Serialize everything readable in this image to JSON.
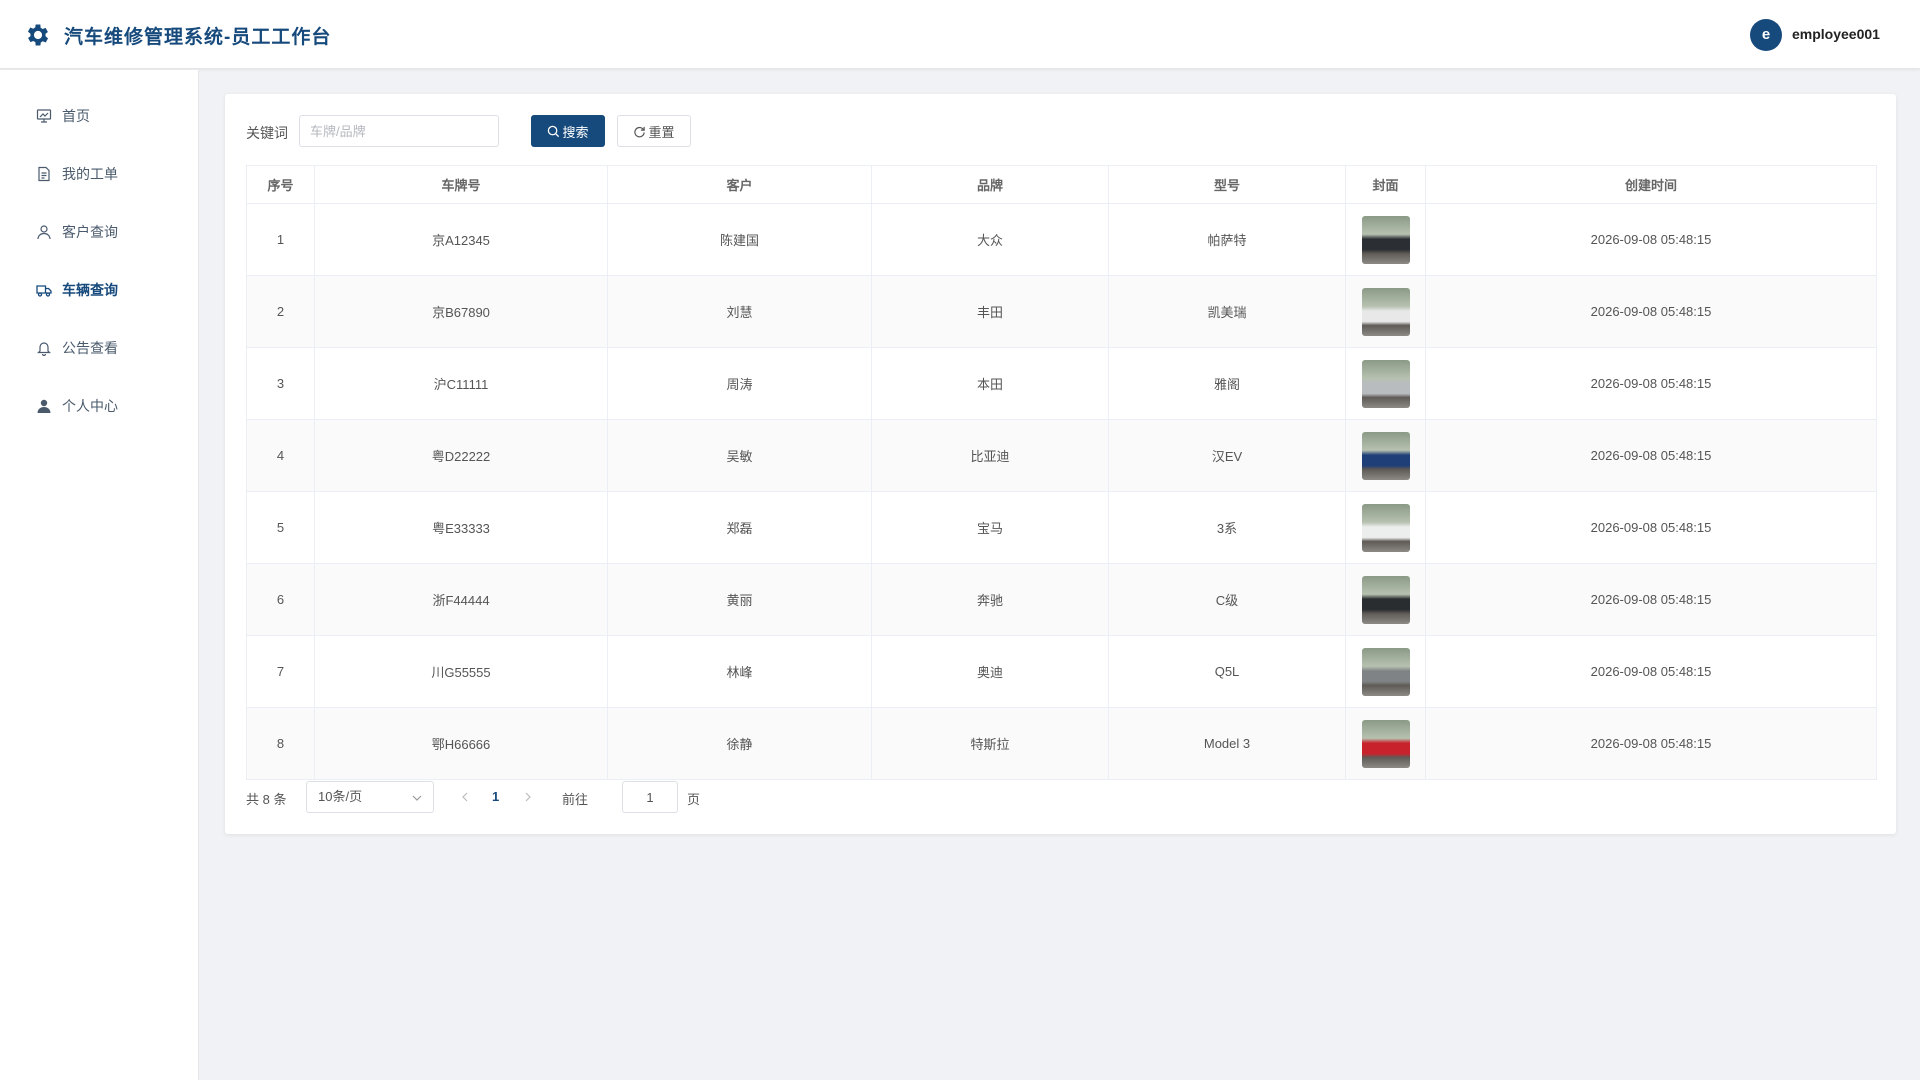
{
  "header": {
    "app_title": "汽车维修管理系统-员工工作台",
    "avatar_letter": "e",
    "username": "employee001",
    "brand_color": "#174a7c"
  },
  "sidebar": {
    "items": [
      {
        "label": "首页",
        "icon": "dashboard-icon",
        "active": false
      },
      {
        "label": "我的工单",
        "icon": "document-icon",
        "active": false
      },
      {
        "label": "客户查询",
        "icon": "user-icon",
        "active": false
      },
      {
        "label": "车辆查询",
        "icon": "truck-icon",
        "active": true
      },
      {
        "label": "公告查看",
        "icon": "bell-icon",
        "active": false
      },
      {
        "label": "个人中心",
        "icon": "person-icon",
        "active": false
      }
    ]
  },
  "search": {
    "label": "关键词",
    "placeholder": "车牌/品牌",
    "value": "",
    "search_label": "搜索",
    "reset_label": "重置"
  },
  "table": {
    "columns": [
      "序号",
      "车牌号",
      "客户",
      "品牌",
      "型号",
      "封面",
      "创建时间"
    ],
    "rows": [
      {
        "index": "1",
        "plate": "京A12345",
        "customer": "陈建国",
        "brand": "大众",
        "model": "帕萨特",
        "cover_color": "#2b2f33",
        "created": "2026-09-08 05:48:15"
      },
      {
        "index": "2",
        "plate": "京B67890",
        "customer": "刘慧",
        "brand": "丰田",
        "model": "凯美瑞",
        "cover_color": "#e8e8e8",
        "created": "2026-09-08 05:48:15"
      },
      {
        "index": "3",
        "plate": "沪C11111",
        "customer": "周涛",
        "brand": "本田",
        "model": "雅阁",
        "cover_color": "#b9bcbe",
        "created": "2026-09-08 05:48:15"
      },
      {
        "index": "4",
        "plate": "粤D22222",
        "customer": "吴敏",
        "brand": "比亚迪",
        "model": "汉EV",
        "cover_color": "#1f3f78",
        "created": "2026-09-08 05:48:15"
      },
      {
        "index": "5",
        "plate": "粤E33333",
        "customer": "郑磊",
        "brand": "宝马",
        "model": "3系",
        "cover_color": "#eceeee",
        "created": "2026-09-08 05:48:15"
      },
      {
        "index": "6",
        "plate": "浙F44444",
        "customer": "黄丽",
        "brand": "奔驰",
        "model": "C级",
        "cover_color": "#2a2d30",
        "created": "2026-09-08 05:48:15"
      },
      {
        "index": "7",
        "plate": "川G55555",
        "customer": "林峰",
        "brand": "奥迪",
        "model": "Q5L",
        "cover_color": "#7f8386",
        "created": "2026-09-08 05:48:15"
      },
      {
        "index": "8",
        "plate": "鄂H66666",
        "customer": "徐静",
        "brand": "特斯拉",
        "model": "Model 3",
        "cover_color": "#c8232c",
        "created": "2026-09-08 05:48:15"
      }
    ]
  },
  "pagination": {
    "total_text": "共 8 条",
    "page_size": "10条/页",
    "current_page": "1",
    "goto_label": "前往",
    "goto_value": "1",
    "goto_suffix": "页"
  }
}
